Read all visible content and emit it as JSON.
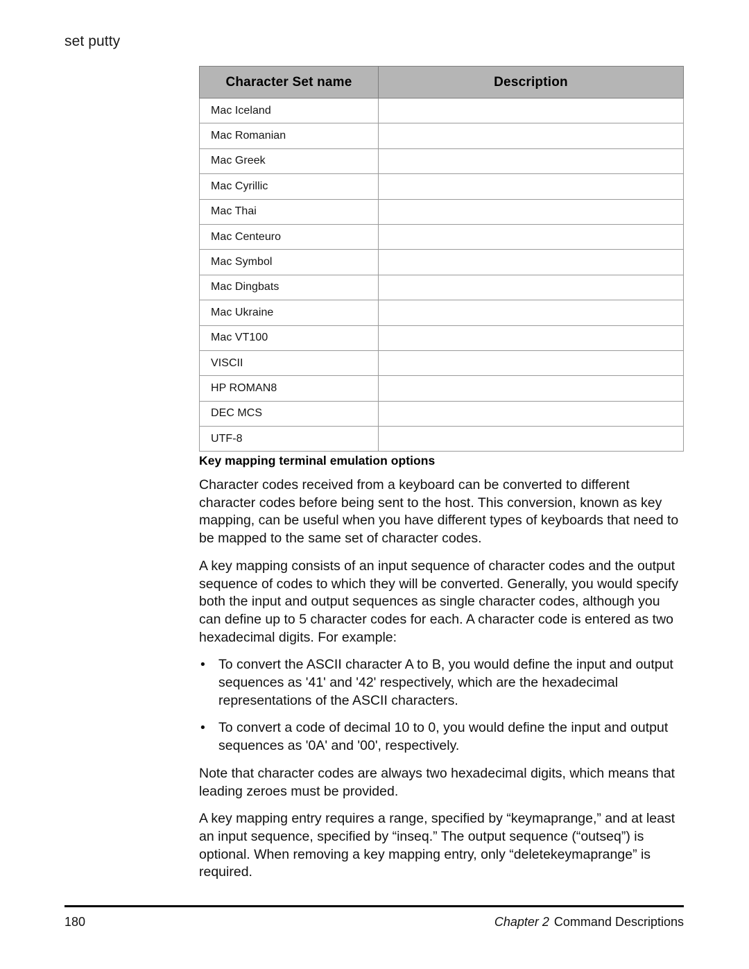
{
  "running_head": "set putty",
  "table": {
    "headers": [
      "Character Set name",
      "Description"
    ],
    "rows": [
      {
        "name": "Mac Iceland",
        "description": ""
      },
      {
        "name": "Mac Romanian",
        "description": ""
      },
      {
        "name": "Mac Greek",
        "description": ""
      },
      {
        "name": "Mac Cyrillic",
        "description": ""
      },
      {
        "name": "Mac Thai",
        "description": ""
      },
      {
        "name": "Mac Centeuro",
        "description": ""
      },
      {
        "name": "Mac Symbol",
        "description": ""
      },
      {
        "name": "Mac Dingbats",
        "description": ""
      },
      {
        "name": "Mac Ukraine",
        "description": ""
      },
      {
        "name": "Mac VT100",
        "description": ""
      },
      {
        "name": "VISCII",
        "description": ""
      },
      {
        "name": "HP ROMAN8",
        "description": ""
      },
      {
        "name": "DEC MCS",
        "description": ""
      },
      {
        "name": "UTF-8",
        "description": ""
      }
    ],
    "header_background": "#b5b5b5",
    "border_color": "#9a9a9a"
  },
  "section": {
    "heading": "Key mapping terminal emulation options",
    "paragraph_1": "Character codes received from a keyboard can be converted to different character codes before being sent to the host. This conversion, known as key mapping, can be useful when you have different types of keyboards that need to be mapped to the same set of character codes.",
    "paragraph_2": "A key mapping consists of an input sequence of character codes and the output sequence of codes to which they will be converted. Generally, you would specify both the input and output sequences as single character codes, although you can define up to 5 character codes for each. A character code is entered as two hexadecimal digits. For example:",
    "bullets": [
      {
        "marker": "•",
        "text": "To convert the ASCII character A to B, you would define the input and output sequences as '41' and '42' respectively, which are the hexadecimal representations of the ASCII characters."
      },
      {
        "marker": "•",
        "text": "To convert a code of decimal 10 to 0, you would define the input and output sequences as '0A' and '00', respectively."
      }
    ],
    "paragraph_3": "Note that character codes are always two hexadecimal digits, which means that leading zeroes must be provided.",
    "paragraph_4": "A key mapping entry requires a range, specified by “keymaprange,” and at least an input sequence, specified by “inseq.” The output sequence (“outseq”) is optional. When removing a key mapping entry, only “deletekeymaprange” is required."
  },
  "footer": {
    "page_number": "180",
    "chapter_label": "Chapter 2",
    "chapter_title": "Command Descriptions"
  }
}
